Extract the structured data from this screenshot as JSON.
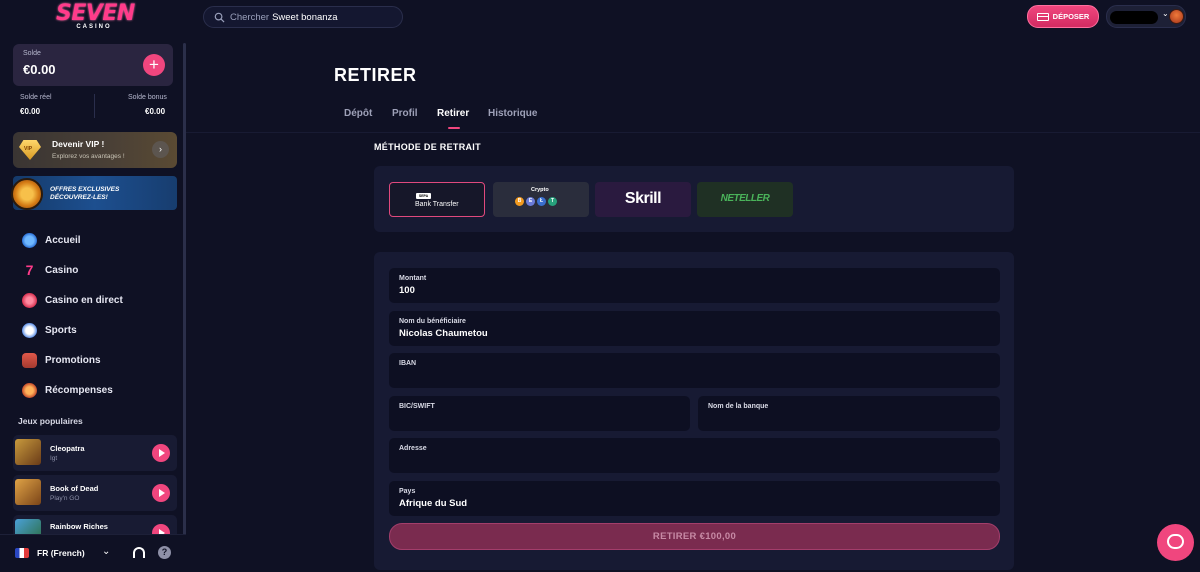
{
  "brand": {
    "name": "SEVEN",
    "sub": "CASINO",
    "accent": "#f0467e"
  },
  "search": {
    "placeholder": "Chercher",
    "term": "Sweet bonanza"
  },
  "header": {
    "deposit_label": "DÉPOSER"
  },
  "balance": {
    "label": "Solde",
    "value": "€0.00",
    "real_label": "Solde réel",
    "real_value": "€0.00",
    "bonus_label": "Solde bonus",
    "bonus_value": "€0.00",
    "add_symbol": "+"
  },
  "vip": {
    "badge": "VIP",
    "title": "Devenir VIP !",
    "subtitle": "Explorez vos avantages !",
    "go": "›"
  },
  "offers": {
    "line1": "OFFRES EXCLUSIVES",
    "line2": "DÉCOUVREZ-LES!"
  },
  "nav": [
    {
      "label": "Accueil",
      "icon": "home-icon"
    },
    {
      "label": "Casino",
      "icon": "seven-icon"
    },
    {
      "label": "Casino en direct",
      "icon": "live-casino-icon"
    },
    {
      "label": "Sports",
      "icon": "soccer-ball-icon"
    },
    {
      "label": "Promotions",
      "icon": "gift-icon"
    },
    {
      "label": "Récompenses",
      "icon": "trophy-icon"
    }
  ],
  "popular": {
    "title": "Jeux populaires",
    "games": [
      {
        "name": "Cleopatra",
        "provider": "Igt"
      },
      {
        "name": "Book of Dead",
        "provider": "Play'n GO"
      },
      {
        "name": "Rainbow Riches",
        "provider": ""
      }
    ]
  },
  "language": {
    "label": "FR (French)",
    "help": "?"
  },
  "page": {
    "title": "RETIRER"
  },
  "tabs": [
    {
      "label": "Dépôt"
    },
    {
      "label": "Profil"
    },
    {
      "label": "Retirer",
      "active": true
    },
    {
      "label": "Historique"
    }
  ],
  "withdraw": {
    "method_heading": "MÉTHODE DE RETRAIT",
    "methods": [
      {
        "label": "Bank Transfer",
        "badge": "SEPA"
      },
      {
        "label": "Crypto",
        "coins": [
          "B",
          "E",
          "Ł",
          "T"
        ]
      },
      {
        "label": "Skrill"
      },
      {
        "label": "NETELLER"
      }
    ],
    "fields": {
      "amount": {
        "label": "Montant",
        "value": "100"
      },
      "beneficiary": {
        "label": "Nom du bénéficiaire",
        "value": "Nicolas Chaumetou"
      },
      "iban": {
        "label": "IBAN",
        "value": ""
      },
      "bic": {
        "label": "BIC/SWIFT",
        "value": ""
      },
      "bank_name": {
        "label": "Nom de la banque",
        "value": ""
      },
      "address": {
        "label": "Adresse",
        "value": ""
      },
      "country": {
        "label": "Pays",
        "value": "Afrique du Sud"
      }
    },
    "submit_label": "RETIRER €100,00"
  }
}
